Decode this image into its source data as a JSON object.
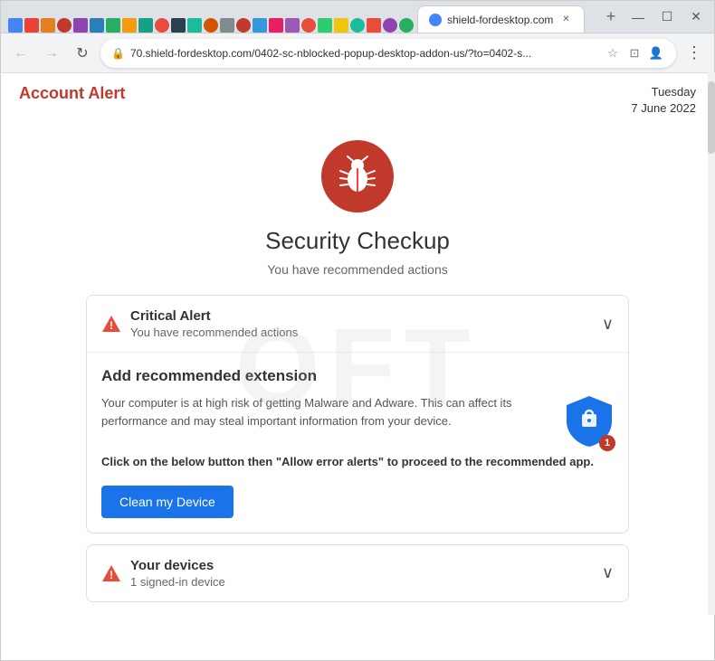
{
  "browser": {
    "tab_label": "shield-fordesktop.com",
    "url": "70.shield-fordesktop.com/0402-sc-nblocked-popup-desktop-addon-us/?to=0402-s...",
    "nav": {
      "back": "←",
      "forward": "→",
      "reload": "↻"
    },
    "window_controls": {
      "minimize": "—",
      "maximize": "☐",
      "close": "✕"
    }
  },
  "page": {
    "account_alert_label": "Account Alert",
    "date_day": "Tuesday",
    "date_full": "7 June 2022",
    "security_title": "Security Checkup",
    "security_subtitle": "You have recommended actions",
    "cards": [
      {
        "id": "critical-alert",
        "icon_type": "warning",
        "title": "Critical Alert",
        "subtitle": "You have recommended actions",
        "expanded": true,
        "body": {
          "title": "Add recommended extension",
          "description": "Your computer is at high risk of getting Malware and Adware. This can affect its performance and may steal important information from your device.",
          "instruction": "Click on the below button then \"Allow error alerts\" to proceed to the recommended app.",
          "button_label": "Clean my Device",
          "badge_count": "1"
        }
      },
      {
        "id": "your-devices",
        "icon_type": "warning",
        "title": "Your devices",
        "subtitle": "1 signed-in device",
        "expanded": false
      }
    ]
  }
}
